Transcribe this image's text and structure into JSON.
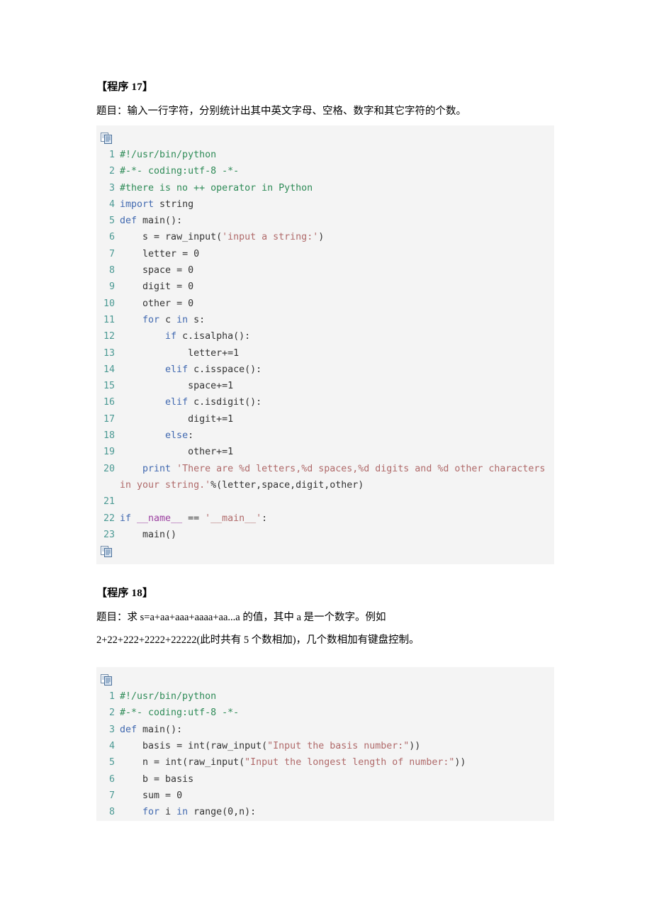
{
  "document": {
    "title": "Python 练习实例 程序17-18",
    "background_color": "#ffffff",
    "code_background_color": "#f4f4f4",
    "line_number_color": "#4c9a94",
    "comment_color": "#2e8b57",
    "keyword_color": "#4169b0",
    "string_color": "#b06a6a",
    "variable_color": "#9b3fa0"
  },
  "sections": [
    {
      "heading": "【程序 17】",
      "prose": [
        "题目：输入一行字符，分别统计出其中英文字母、空格、数字和其它字符的个数。"
      ],
      "copy_icon": "copy-icon",
      "code": {
        "language": "python",
        "lines": [
          {
            "n": "1",
            "tokens": [
              {
                "t": "com",
                "v": "#!/usr/bin/python"
              }
            ]
          },
          {
            "n": "2",
            "tokens": [
              {
                "t": "com",
                "v": "#-*- coding:utf-8 -*-"
              }
            ]
          },
          {
            "n": "3",
            "tokens": [
              {
                "t": "com",
                "v": "#there is no ++ operator in Python"
              }
            ]
          },
          {
            "n": "4",
            "tokens": [
              {
                "t": "kw",
                "v": "import"
              },
              {
                "t": "plain",
                "v": " string"
              }
            ]
          },
          {
            "n": "5",
            "tokens": [
              {
                "t": "kw",
                "v": "def"
              },
              {
                "t": "plain",
                "v": " main():"
              }
            ]
          },
          {
            "n": "6",
            "tokens": [
              {
                "t": "plain",
                "v": "    s = raw_input("
              },
              {
                "t": "str",
                "v": "'input a string:'"
              },
              {
                "t": "plain",
                "v": ")"
              }
            ]
          },
          {
            "n": "7",
            "tokens": [
              {
                "t": "plain",
                "v": "    letter = 0"
              }
            ]
          },
          {
            "n": "8",
            "tokens": [
              {
                "t": "plain",
                "v": "    space = 0"
              }
            ]
          },
          {
            "n": "9",
            "tokens": [
              {
                "t": "plain",
                "v": "    digit = 0"
              }
            ]
          },
          {
            "n": "10",
            "tokens": [
              {
                "t": "plain",
                "v": "    other = 0"
              }
            ]
          },
          {
            "n": "11",
            "tokens": [
              {
                "t": "plain",
                "v": "    "
              },
              {
                "t": "kw",
                "v": "for"
              },
              {
                "t": "plain",
                "v": " c "
              },
              {
                "t": "kw",
                "v": "in"
              },
              {
                "t": "plain",
                "v": " s:"
              }
            ]
          },
          {
            "n": "12",
            "tokens": [
              {
                "t": "plain",
                "v": "        "
              },
              {
                "t": "kw",
                "v": "if"
              },
              {
                "t": "plain",
                "v": " c.isalpha():"
              }
            ]
          },
          {
            "n": "13",
            "tokens": [
              {
                "t": "plain",
                "v": "            letter+=1"
              }
            ]
          },
          {
            "n": "14",
            "tokens": [
              {
                "t": "plain",
                "v": "        "
              },
              {
                "t": "kw",
                "v": "elif"
              },
              {
                "t": "plain",
                "v": " c.isspace():"
              }
            ]
          },
          {
            "n": "15",
            "tokens": [
              {
                "t": "plain",
                "v": "            space+=1"
              }
            ]
          },
          {
            "n": "16",
            "tokens": [
              {
                "t": "plain",
                "v": "        "
              },
              {
                "t": "kw",
                "v": "elif"
              },
              {
                "t": "plain",
                "v": " c.isdigit():"
              }
            ]
          },
          {
            "n": "17",
            "tokens": [
              {
                "t": "plain",
                "v": "            digit+=1"
              }
            ]
          },
          {
            "n": "18",
            "tokens": [
              {
                "t": "plain",
                "v": "        "
              },
              {
                "t": "kw",
                "v": "else"
              },
              {
                "t": "plain",
                "v": ":"
              }
            ]
          },
          {
            "n": "19",
            "tokens": [
              {
                "t": "plain",
                "v": "            other+=1"
              }
            ]
          },
          {
            "n": "20",
            "tokens": [
              {
                "t": "plain",
                "v": "    "
              },
              {
                "t": "kw",
                "v": "print"
              },
              {
                "t": "plain",
                "v": " "
              },
              {
                "t": "str",
                "v": "'There are %d letters,%d spaces,%d digits and %d other characters in your string.'"
              },
              {
                "t": "plain",
                "v": "%(letter,space,digit,other)"
              }
            ]
          },
          {
            "n": "21",
            "tokens": [
              {
                "t": "plain",
                "v": ""
              }
            ]
          },
          {
            "n": "22",
            "tokens": [
              {
                "t": "kw",
                "v": "if"
              },
              {
                "t": "plain",
                "v": " "
              },
              {
                "t": "var",
                "v": "__name__"
              },
              {
                "t": "plain",
                "v": " == "
              },
              {
                "t": "str",
                "v": "'__main__'"
              },
              {
                "t": "plain",
                "v": ":"
              }
            ]
          },
          {
            "n": "23",
            "tokens": [
              {
                "t": "plain",
                "v": "    main()"
              }
            ]
          }
        ]
      },
      "copy_icon_bottom": "copy-icon",
      "clipped": false
    },
    {
      "heading": "【程序 18】",
      "prose": [
        "题目：求 s=a+aa+aaa+aaaa+aa...a 的值，其中 a 是一个数字。例如",
        "2+22+222+2222+22222(此时共有 5 个数相加)，几个数相加有键盘控制。"
      ],
      "copy_icon": "copy-icon",
      "code": {
        "language": "python",
        "lines": [
          {
            "n": "1",
            "tokens": [
              {
                "t": "com",
                "v": "#!/usr/bin/python"
              }
            ]
          },
          {
            "n": "2",
            "tokens": [
              {
                "t": "com",
                "v": "#-*- coding:utf-8 -*-"
              }
            ]
          },
          {
            "n": "3",
            "tokens": [
              {
                "t": "kw",
                "v": "def"
              },
              {
                "t": "plain",
                "v": " main():"
              }
            ]
          },
          {
            "n": "4",
            "tokens": [
              {
                "t": "plain",
                "v": "    basis = int(raw_input("
              },
              {
                "t": "str",
                "v": "\"Input the basis number:\""
              },
              {
                "t": "plain",
                "v": "))"
              }
            ]
          },
          {
            "n": "5",
            "tokens": [
              {
                "t": "plain",
                "v": "    n = int(raw_input("
              },
              {
                "t": "str",
                "v": "\"Input the longest length of number:\""
              },
              {
                "t": "plain",
                "v": "))"
              }
            ]
          },
          {
            "n": "6",
            "tokens": [
              {
                "t": "plain",
                "v": "    b = basis"
              }
            ]
          },
          {
            "n": "7",
            "tokens": [
              {
                "t": "plain",
                "v": "    sum = 0"
              }
            ]
          },
          {
            "n": "8",
            "tokens": [
              {
                "t": "plain",
                "v": "    "
              },
              {
                "t": "kw",
                "v": "for"
              },
              {
                "t": "plain",
                "v": " i "
              },
              {
                "t": "kw",
                "v": "in"
              },
              {
                "t": "plain",
                "v": " range(0,n):"
              }
            ]
          }
        ]
      },
      "copy_icon_bottom": null,
      "clipped": true
    }
  ]
}
